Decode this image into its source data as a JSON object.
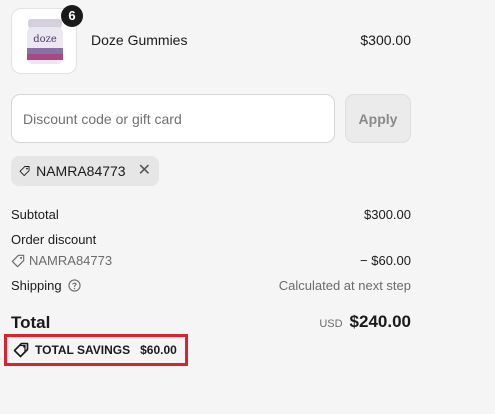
{
  "cart_item": {
    "quantity": "6",
    "name": "Doze Gummies",
    "price": "$300.00",
    "image_label": "doze"
  },
  "discount": {
    "placeholder": "Discount code or gift card",
    "apply_label": "Apply",
    "applied_code": "NAMRA84773"
  },
  "summary": {
    "subtotal_label": "Subtotal",
    "subtotal_value": "$300.00",
    "order_discount_label": "Order discount",
    "discount_code": "NAMRA84773",
    "discount_value": "− $60.00",
    "shipping_label": "Shipping",
    "shipping_value": "Calculated at next step",
    "total_label": "Total",
    "currency": "USD",
    "total_value": "$240.00",
    "savings_label": "TOTAL SAVINGS",
    "savings_value": "$60.00"
  },
  "colors": {
    "highlight_border": "#d9232d",
    "chip_bg": "#e6e6e6",
    "jar_lid": "#c9c2d3",
    "jar_band": "#6a4a8c"
  }
}
